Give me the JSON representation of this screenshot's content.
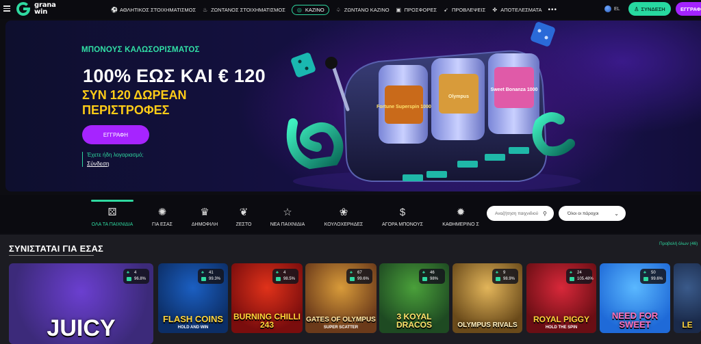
{
  "header": {
    "logo_line1": "grana",
    "logo_line2": "win",
    "nav": [
      {
        "label": "ΑΘΛΗΤΙΚΟΣ ΣΤΟΙΧΗΜΑΤΙΣΜΟΣ",
        "icon": "soccer-ball-icon"
      },
      {
        "label": "ΖΩΝΤΑΝΟΣ ΣΤΟΙΧΗΜΑΤΙΣΜΟΣ",
        "icon": "flame-icon"
      },
      {
        "label": "ΚΑΖΙΝΟ",
        "icon": "casino-chip-icon",
        "active": true
      },
      {
        "label": "ΖΩΝΤΑΝΟ ΚΑΖΙΝΟ",
        "icon": "live-casino-icon"
      },
      {
        "label": "ΠΡΟΣΦΟΡΕΣ",
        "icon": "gift-icon"
      },
      {
        "label": "ΠΡΟΒΛΕΨΕΙΣ",
        "icon": "cursor-icon"
      },
      {
        "label": "ΑΠΟΤΕΛΕΣΜΑΤΑ",
        "icon": "trophy-icon"
      }
    ],
    "more": "•••",
    "language": "EL",
    "login_label": "ΣΥΝΔΕΣΗ",
    "register_label": "ΕΓΓΡΑΦ"
  },
  "hero": {
    "kicker": "ΜΠΟΝΟΥΣ ΚΑΛΩΣΟΡΙΣΜΑΤΟΣ",
    "title": "100% ΕΩΣ ΚΑΙ € 120",
    "subtitle": "ΣΥΝ 120 ΔΩΡΕΑΝ ΠΕΡΙΣΤΡΟΦΕΣ",
    "cta": "ΕΓΓΡΑΦΗ",
    "account_question": "Έχετε ήδη λογαριασμό;",
    "account_link": "Σύνδεση",
    "reels": [
      "Fortune Superspin 1000",
      "Olympus",
      "Sweet Bonanza 1000"
    ]
  },
  "categories": [
    {
      "label": "ΟΛΑ ΤΑ ΠΑΙΧΝΙΔΙΑ",
      "icon": "dice-icon",
      "glyph": "⚄",
      "active": true
    },
    {
      "label": "ΓΙΑ ΕΣΑΣ",
      "icon": "for-you-icon",
      "glyph": "✺"
    },
    {
      "label": "ΔΗΜΟΦΙΛΗ",
      "icon": "crown-icon",
      "glyph": "♛"
    },
    {
      "label": "ΖΕΣΤΟ",
      "icon": "chili-icon",
      "glyph": "❦"
    },
    {
      "label": "ΝΕΑ ΠΑΙΧΝΙΔΙΑ",
      "icon": "star-icon",
      "glyph": "☆"
    },
    {
      "label": "ΚΟΥΛΟΧΕΡΗΔΕΣ",
      "icon": "cherries-icon",
      "glyph": "❀"
    },
    {
      "label": "ΑΓΟΡΑ ΜΠΟΝΟΥΣ",
      "icon": "money-bag-icon",
      "glyph": "$"
    },
    {
      "label": "ΚΑΘΗΜΕΡΙΝΟ Σ",
      "icon": "daily-drop-icon",
      "glyph": "✹"
    }
  ],
  "search": {
    "placeholder": "Αναζήτηση παιχνιδιού"
  },
  "provider_filter": {
    "value": "Όλοι οι πάροχοι"
  },
  "section": {
    "title": "ΣΥΝΙΣΤΑΤΑΙ ΓΙΑ ΕΣΑΣ",
    "see_all": "Προβολή όλων (46)"
  },
  "games": [
    {
      "title": "JUICY",
      "players": "4",
      "rtp": "96.8%",
      "bg1": "#3c2a7a",
      "bg2": "#6b3fd0",
      "title_color": "#ffffff"
    },
    {
      "title": "FLASH COINS",
      "sub": "HOLD AND WIN",
      "players": "41",
      "rtp": "99.3%",
      "bg1": "#0c2e66",
      "bg2": "#1b5fc2",
      "title_color": "#ffd43a"
    },
    {
      "title": "BURNING CHILLI 243",
      "players": "4",
      "rtp": "98.5%",
      "bg1": "#7a0d0d",
      "bg2": "#e0321a",
      "title_color": "#ffd43a"
    },
    {
      "title": "GATES OF OLYMPUS",
      "sub": "SUPER SCATTER",
      "players": "67",
      "rtp": "99.6%",
      "bg1": "#6b3a1a",
      "bg2": "#d89b3a",
      "title_color": "#ffe9a8"
    },
    {
      "title": "3 KOYAL DRACOS",
      "players": "46",
      "rtp": "98%",
      "bg1": "#1e4a22",
      "bg2": "#4aa03a",
      "title_color": "#ffe26a"
    },
    {
      "title": "OLYMPUS RIVALS",
      "players": "9",
      "rtp": "98.9%",
      "bg1": "#6a4a1a",
      "bg2": "#e2b55a",
      "title_color": "#fff1c2"
    },
    {
      "title": "ROYAL PIGGY",
      "sub": "HOLD THE SPIN",
      "players": "24",
      "rtp": "105.48%",
      "bg1": "#6a0e14",
      "bg2": "#d8283a",
      "title_color": "#ffd43a"
    },
    {
      "title": "NEED FOR SWEET",
      "players": "50",
      "rtp": "99.6%",
      "bg1": "#1f6ad8",
      "bg2": "#5ab8ff",
      "title_color": "#ff6fb8"
    },
    {
      "title": "LE",
      "bg1": "#1a2a4a",
      "bg2": "#3a5a8a",
      "title_color": "#ffd43a"
    }
  ],
  "colors": {
    "accent_green": "#2fd9a0",
    "accent_purple": "#a624ff",
    "promo_yellow": "#ffcc17"
  }
}
